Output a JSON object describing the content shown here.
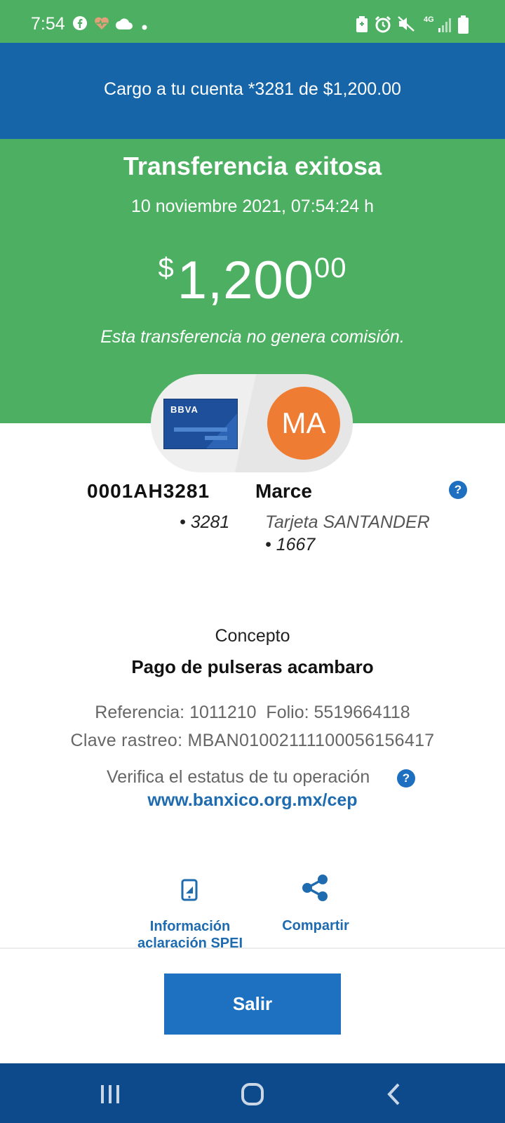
{
  "status_bar": {
    "time": "7:54",
    "network": "4G",
    "icons": [
      "facebook-icon",
      "health-icon",
      "cloud-icon",
      "dot-icon",
      "battery-saver-icon",
      "alarm-icon",
      "mute-icon",
      "signal-icon",
      "battery-icon"
    ]
  },
  "header": {
    "text": "Cargo a tu cuenta *3281 de $1,200.00"
  },
  "hero": {
    "title": "Transferencia exitosa",
    "date": "10 noviembre 2021, 07:54:24 h",
    "amount_currency": "$",
    "amount_whole": "1,200",
    "amount_cents": "00",
    "note": "Esta transferencia no genera comisión."
  },
  "origin": {
    "card_brand": "BBVA",
    "name": "0001AH3281",
    "last_digits": "• 3281"
  },
  "destination": {
    "initials": "MA",
    "name": "Marce",
    "bank": "Tarjeta SANTANDER",
    "last_digits": "• 1667"
  },
  "help_symbol": "?",
  "concept": {
    "label": "Concepto",
    "value": "Pago de pulseras acambaro"
  },
  "details": {
    "reference_line": "Referencia: 1011210  Folio: 5519664118",
    "tracking_line": "Clave rastreo: MBAN01002111100056156417",
    "verify_text": "Verifica el estatus de tu operación",
    "verify_link": "www.banxico.org.mx/cep"
  },
  "actions": {
    "info_label": "Información aclaración SPEI",
    "share_label": "Compartir"
  },
  "exit_button": "Salir",
  "colors": {
    "green": "#4caf61",
    "blue_header": "#1565a8",
    "accent_blue": "#1e71c0",
    "nav_blue": "#0d4a8c",
    "avatar_orange": "#ee7d33"
  }
}
